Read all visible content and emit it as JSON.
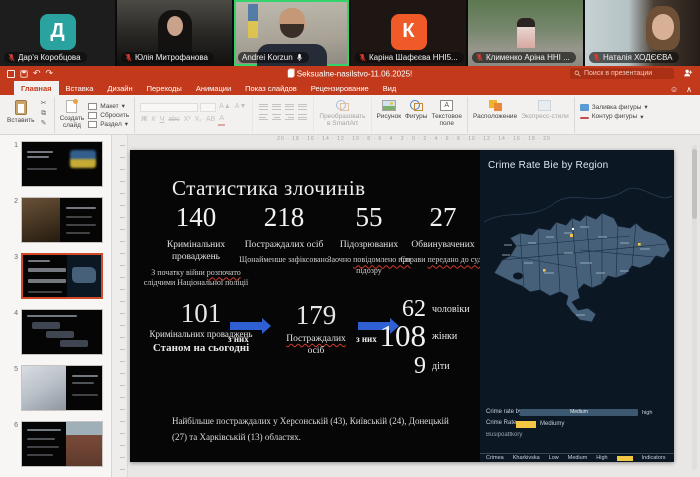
{
  "icons": {
    "undo": "↶",
    "redo": "↷",
    "caret": "▾",
    "smiley": "☺",
    "collapse": "∧",
    "scissors": "✂",
    "copy": "⧉",
    "brush": "✎"
  },
  "meeting": {
    "participants": [
      {
        "name": "Дар'я Коробцова",
        "avatar_letter": "Д",
        "avatar_color": "#2aa3a0",
        "muted": true
      },
      {
        "name": "Юлія Митрофанова",
        "muted": true
      },
      {
        "name": "Andrei Korzun",
        "muted": false,
        "speaking": true
      },
      {
        "name": "Каріна Шафєєва ННІ5...",
        "avatar_letter": "К",
        "avatar_color": "#f05a28",
        "muted": true
      },
      {
        "name": "Клименко Аріна ННІ ...",
        "muted": true
      },
      {
        "name": "Наталія ХОДЄЄВА",
        "muted": true
      }
    ]
  },
  "powerpoint": {
    "window_title": "Seksualne-nasilstvo-11.06.2025!",
    "search_placeholder": "Поиск в презентации",
    "tabs": [
      "Главная",
      "Вставка",
      "Дизайн",
      "Переходы",
      "Анимации",
      "Показ слайдов",
      "Рецензирование",
      "Вид"
    ],
    "active_tab": "Главная",
    "ribbon": {
      "paste": "Вставить",
      "new_slide_1": "Создать",
      "new_slide_2": "слайд",
      "layout": "Макет",
      "reset": "Сбросить",
      "section": "Раздел",
      "bold": "Ж",
      "italic": "К",
      "underline": "Ч",
      "strike": "abc",
      "sup": "X²",
      "sub": "X₂",
      "spacing": "АВ",
      "fontcolor": "А",
      "smartart_1": "Преобразовать",
      "smartart_2": "в SmartArt",
      "picture": "Рисунок",
      "shapes": "Фигуры",
      "textbox_1": "Текстовое",
      "textbox_2": "поле",
      "arrange": "Расположение",
      "quick_styles": "Экспресс-стили",
      "shape_fill": "Заливка фигуры",
      "shape_outline": "Контур фигуры"
    },
    "ruler": "20 · 18 · 16 · 14 · 12 · 10 · 8 · 6 · 4 · 2 · 0 · 2 · 4 · 6 · 8 · 10 · 12 · 14 · 16 · 18 · 20",
    "thumbnails": {
      "numbers": [
        "1",
        "2",
        "3",
        "4",
        "5",
        "6"
      ],
      "selected_index": 3
    }
  },
  "slide": {
    "title": "Статистика злочинів",
    "stats": [
      {
        "value": "140",
        "label": "Кримінальних проваджень",
        "sub_pre": "З початку війни ",
        "sub_marked": "розпочато",
        "sub_post": " слідчими Національної поліції"
      },
      {
        "value": "218",
        "label": "Постраждалих осіб",
        "sub_pre": "Щонайменше зафіксовано",
        "sub_marked": "",
        "sub_post": ""
      },
      {
        "value": "55",
        "label": "Підозрюваних",
        "sub_pre": "Заочно ",
        "sub_marked": "повідомлено про",
        "sub_post": " підозру"
      },
      {
        "value": "27",
        "label": "Обвинувачених",
        "sub_pre": "Справи ",
        "sub_marked": "передано до суду",
        "sub_post": ""
      }
    ],
    "flow": {
      "count": "101",
      "count_label": "Кримінальних проваджень",
      "count_sub": "Станом на сьогодні",
      "arrow_label": "з них",
      "victims": "179",
      "victims_label_marked": "Постраждалих",
      "victims_label_rest": "осіб",
      "breakdown": [
        {
          "value": "62",
          "label": "чоловіки"
        },
        {
          "value": "108",
          "label": "жінки"
        },
        {
          "value": "9",
          "label": "діти"
        }
      ]
    },
    "footnote": "Найбільше постраждалих у Херсонській (43), Київській (24), Донецькій (27) та Харківській (13) областях.",
    "map_panel": {
      "title": "Crime Rate Bie by Region",
      "legend": {
        "rate_by_label": "Crime rate by",
        "bar_value": "Medium",
        "bar_right": "high",
        "rate_label": "Crime Rate",
        "rate_value": "Mediumy",
        "extra": "Busipoattkory"
      },
      "footer_items": [
        "Crimea",
        "Kharkivska",
        "Low",
        "Medium",
        "High",
        "Indicators"
      ],
      "colors": {
        "map_fill": "#46607a",
        "panel_bg": "#0c1724",
        "accent_yellow": "#f2c744"
      }
    }
  }
}
